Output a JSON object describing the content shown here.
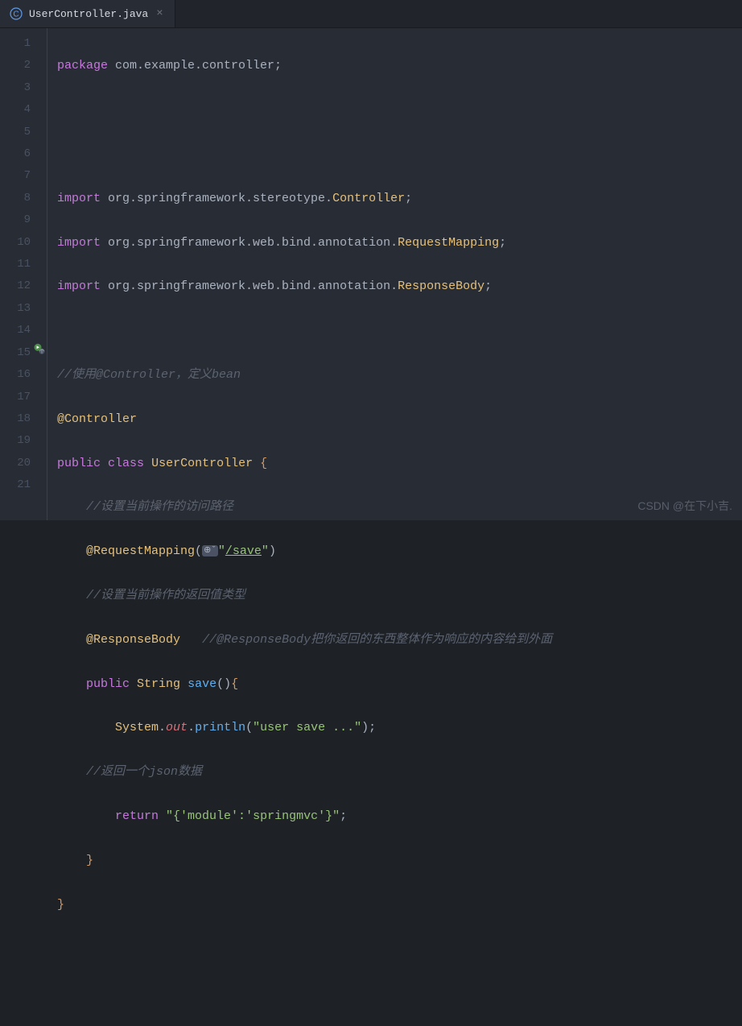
{
  "tab": {
    "filename": "UserController.java",
    "close": "×"
  },
  "gutter": {
    "lines": [
      "1",
      "2",
      "3",
      "4",
      "5",
      "6",
      "7",
      "8",
      "9",
      "10",
      "11",
      "12",
      "13",
      "14",
      "15",
      "16",
      "17",
      "18",
      "19",
      "20",
      "21"
    ]
  },
  "code": {
    "l1": {
      "kw": "package",
      "rest": " com.example.controller;"
    },
    "l4": {
      "kw": "import",
      "pkg": " org.springframework.stereotype.",
      "cls": "Controller",
      "end": ";"
    },
    "l5": {
      "kw": "import",
      "pkg": " org.springframework.web.bind.annotation.",
      "cls": "RequestMapping",
      "end": ";"
    },
    "l6": {
      "kw": "import",
      "pkg": " org.springframework.web.bind.annotation.",
      "cls": "ResponseBody",
      "end": ";"
    },
    "l8": {
      "com": "//使用@Controller，定义bean"
    },
    "l9": {
      "ann": "@Controller"
    },
    "l10": {
      "kw1": "public",
      "kw2": "class",
      "cls": "UserController",
      "br": "{"
    },
    "l11": {
      "com": "//设置当前操作的访问路径"
    },
    "l12": {
      "ann": "@RequestMapping",
      "p1": "(",
      "badge": "⊕ˇ",
      "q1": "\"",
      "str": "/save",
      "q2": "\"",
      "p2": ")"
    },
    "l13": {
      "com": "//设置当前操作的返回值类型"
    },
    "l14": {
      "ann": "@ResponseBody",
      "com": "//@ResponseBody把你返回的东西整体作为响应的内容给到外面"
    },
    "l15": {
      "kw": "public",
      "typ": "String",
      "fn": "save",
      "p": "()",
      "br": "{"
    },
    "l16": {
      "cls": "System",
      "d1": ".",
      "fld": "out",
      "d2": ".",
      "fn": "println",
      "p1": "(",
      "str": "\"user save ...\"",
      "p2": ")",
      "end": ";"
    },
    "l17": {
      "com": "//返回一个json数据"
    },
    "l18": {
      "kw": "return",
      "str": "\"{'module':'springmvc'}\"",
      "end": ";"
    },
    "l19": {
      "br": "}"
    },
    "l20": {
      "br": "}"
    }
  },
  "watermark": "CSDN @在下小吉."
}
